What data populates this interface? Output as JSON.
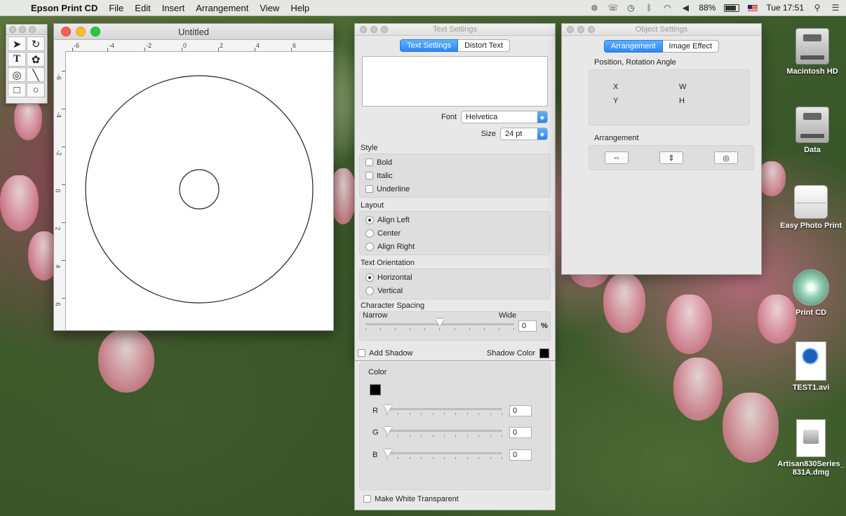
{
  "menubar": {
    "app_name": "Epson Print CD",
    "menus": [
      "File",
      "Edit",
      "Insert",
      "Arrangement",
      "View",
      "Help"
    ],
    "battery": "88%",
    "clock": "Tue 17:51"
  },
  "document": {
    "title": "Untitled",
    "h_ruler_labels": [
      "-6",
      "-4",
      "-2",
      "0",
      "2",
      "4",
      "6"
    ],
    "v_ruler_labels": [
      "-6",
      "-4",
      "-2",
      "0",
      "2",
      "4",
      "6"
    ]
  },
  "text_settings": {
    "title": "Text Settings",
    "tabs": [
      "Text Settings",
      "Distort Text"
    ],
    "font_label": "Font",
    "font_value": "Helvetica",
    "size_label": "Size",
    "size_value": "24 pt",
    "style_label": "Style",
    "styles": [
      "Bold",
      "Italic",
      "Underline"
    ],
    "layout_label": "Layout",
    "layouts": [
      "Align Left",
      "Center",
      "Align Right"
    ],
    "orientation_label": "Text Orientation",
    "orientations": [
      "Horizontal",
      "Vertical"
    ],
    "spacing_label": "Character Spacing",
    "narrow_label": "Narrow",
    "wide_label": "Wide",
    "spacing_value": "0",
    "spacing_unit": "%",
    "spacing_level": 0.5,
    "shadow_label": "Add Shadow",
    "shadow_color_label": "Shadow Color"
  },
  "color": {
    "label": "Color",
    "r_label": "R",
    "g_label": "G",
    "b_label": "B",
    "r_value": "0",
    "g_value": "0",
    "b_value": "0",
    "make_white_label": "Make White Transparent"
  },
  "object_settings": {
    "title": "Object Settings",
    "tabs": [
      "Arrangement",
      "Image Effect"
    ],
    "position_label": "Position, Rotation Angle",
    "x_label": "X",
    "w_label": "W",
    "y_label": "Y",
    "h_label": "H",
    "arrangement_label": "Arrangement"
  },
  "desktop_icons": [
    {
      "label": "Macintosh HD"
    },
    {
      "label": "Data"
    },
    {
      "label": "Easy Photo Print"
    },
    {
      "label": "Print CD"
    },
    {
      "label": "TEST1.avi"
    },
    {
      "label": "Artisan830Series_831A.dmg"
    }
  ],
  "colors": {
    "accent": "#2a86f5",
    "panel_bg": "#e8e8e8"
  }
}
